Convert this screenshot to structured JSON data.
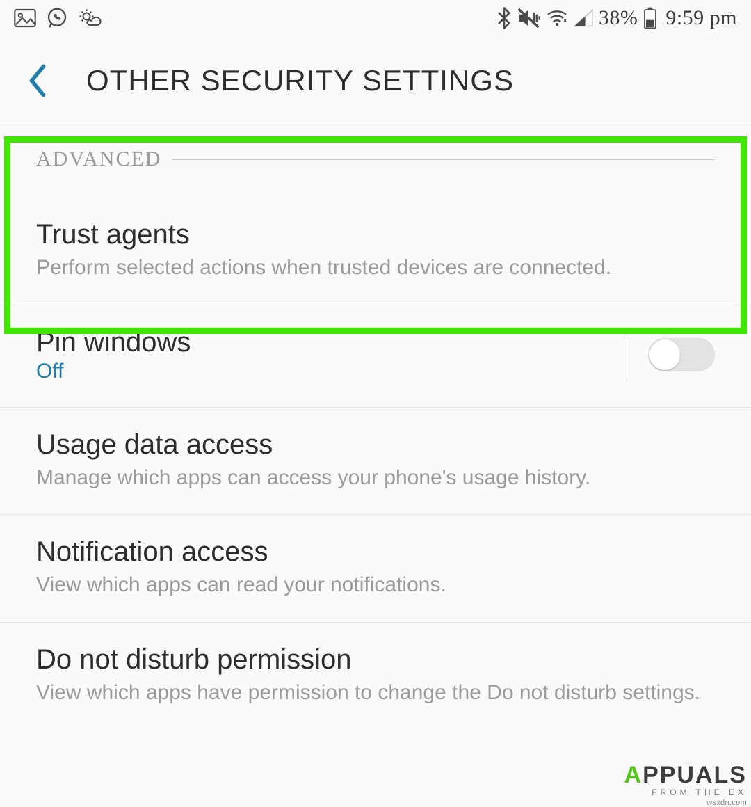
{
  "statusbar": {
    "battery_pct": "38%",
    "time": "9:59 pm"
  },
  "header": {
    "title": "OTHER SECURITY SETTINGS"
  },
  "section": {
    "label": "ADVANCED"
  },
  "items": {
    "trust_agents": {
      "title": "Trust agents",
      "sub": "Perform selected actions when trusted devices are connected."
    },
    "pin_windows": {
      "title": "Pin windows",
      "state": "Off",
      "toggle_on": false
    },
    "usage_data": {
      "title": "Usage data access",
      "sub": "Manage which apps can access your phone's usage history."
    },
    "notification_access": {
      "title": "Notification access",
      "sub": "View which apps can read your notifications."
    },
    "dnd_permission": {
      "title": "Do not disturb permission",
      "sub": "View which apps have permission to change the Do not disturb settings."
    }
  },
  "watermark": {
    "brand_a": "A",
    "brand_rest": "PPUALS",
    "tagline": "FROM  THE  EX",
    "site": "wsxdn.com"
  }
}
